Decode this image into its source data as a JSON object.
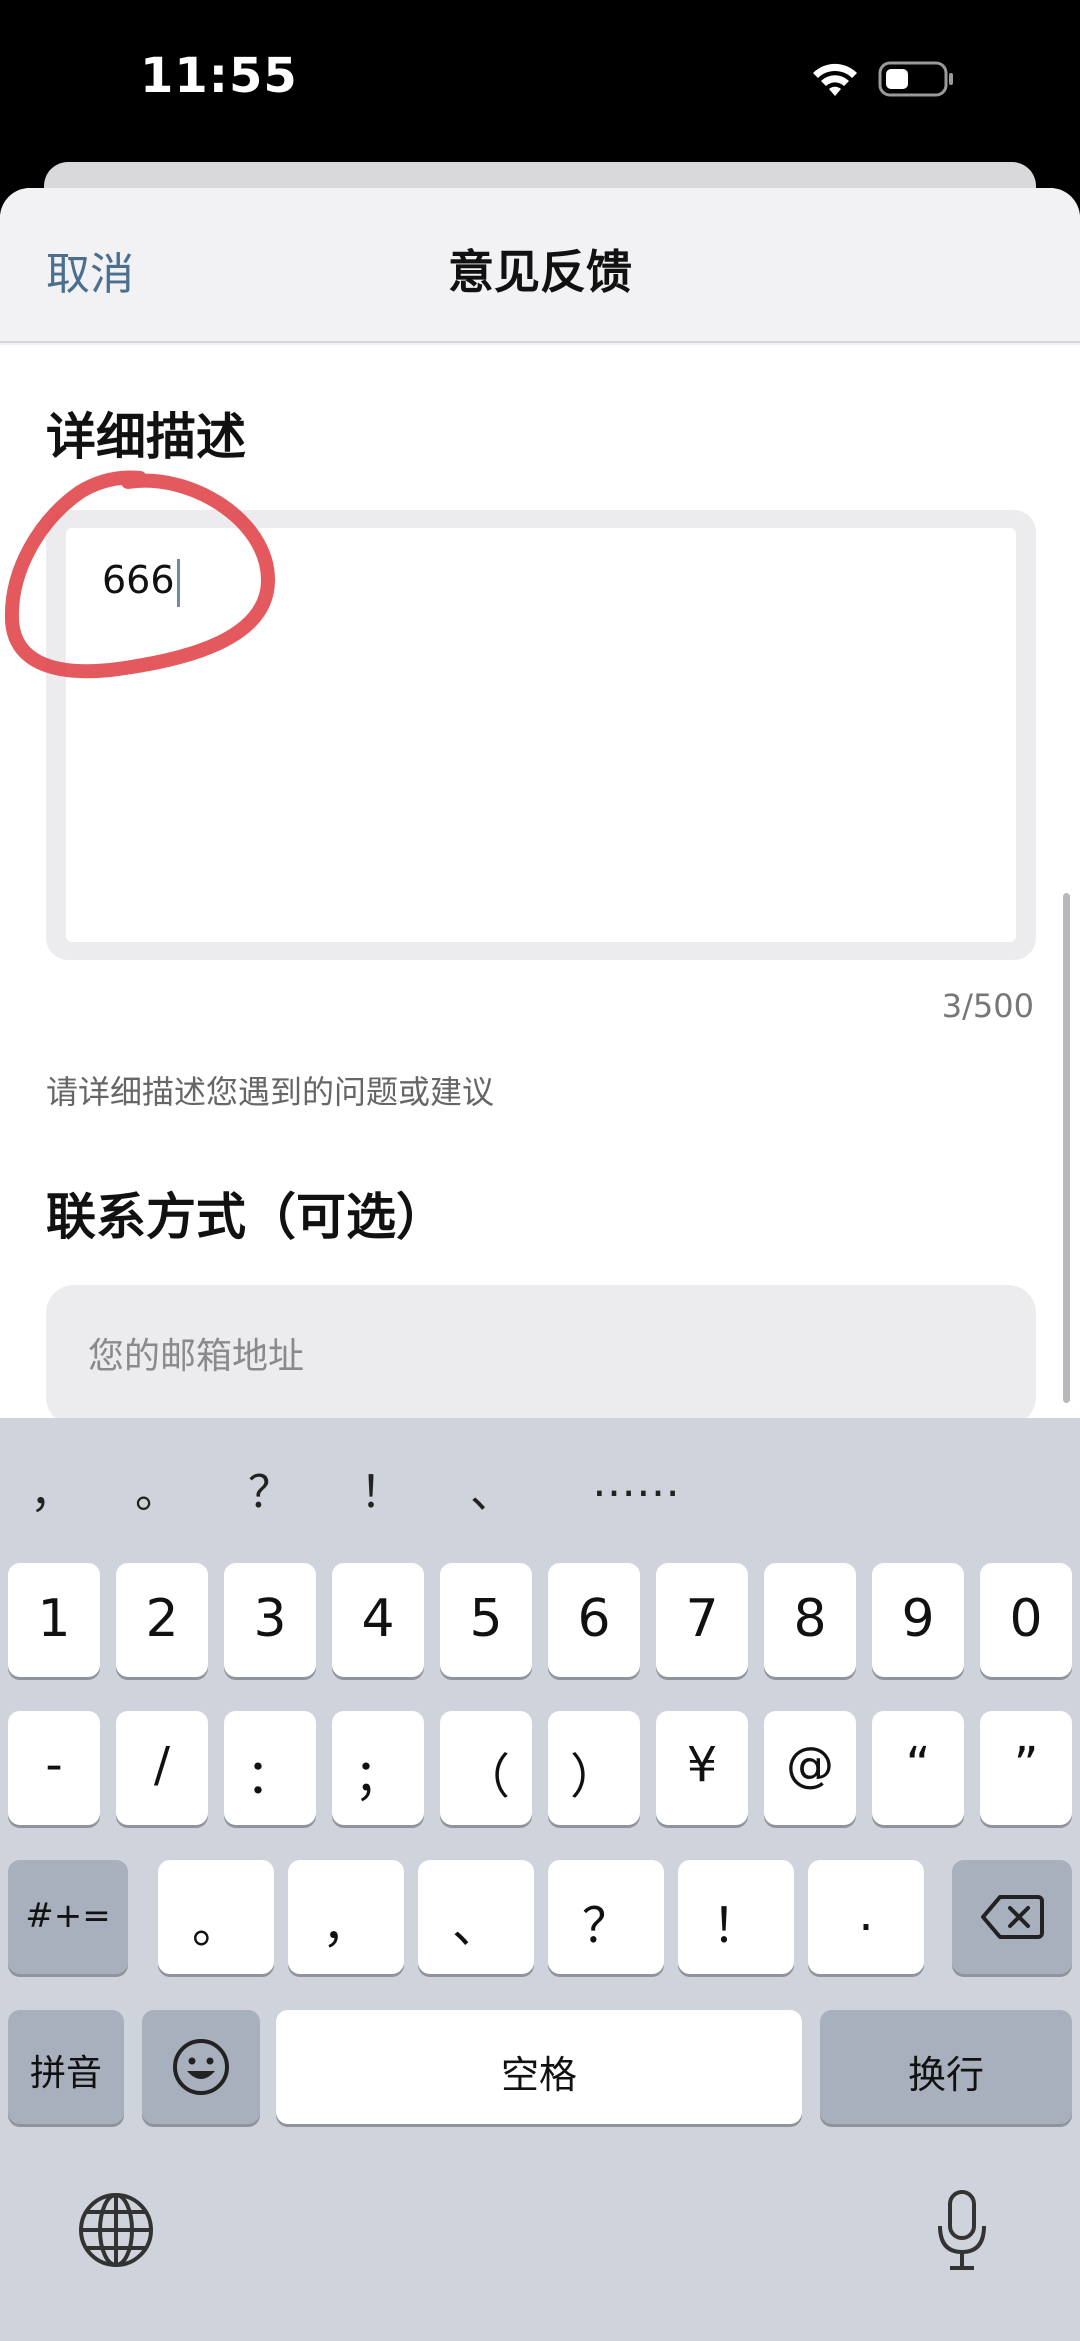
{
  "status_bar": {
    "time": "11:55",
    "wifi_icon": "wifi-icon",
    "battery_icon": "battery-icon"
  },
  "nav": {
    "cancel": "取消",
    "title": "意见反馈"
  },
  "feedback": {
    "description_title": "详细描述",
    "description_value": "666",
    "counter": "3/500",
    "hint": "请详细描述您遇到的问题或建议",
    "contact_title": "联系方式（可选）",
    "email_placeholder": "您的邮箱地址"
  },
  "annotation": {
    "color": "#e0474c"
  },
  "keyboard": {
    "candidates": [
      "，",
      "。",
      "？",
      "！",
      "、",
      "……"
    ],
    "row1": [
      "1",
      "2",
      "3",
      "4",
      "5",
      "6",
      "7",
      "8",
      "9",
      "0"
    ],
    "row2": [
      "-",
      "/",
      "：",
      "；",
      "（",
      "）",
      "¥",
      "@",
      "“",
      "”"
    ],
    "row3_left": "#+=",
    "row3": [
      "。",
      "，",
      "、",
      "？",
      "！",
      "."
    ],
    "backspace_icon": "backspace-icon",
    "pinyin": "拼音",
    "emoji_icon": "emoji-icon",
    "space": "空格",
    "return": "换行",
    "globe_icon": "globe-icon",
    "mic_icon": "microphone-icon"
  }
}
